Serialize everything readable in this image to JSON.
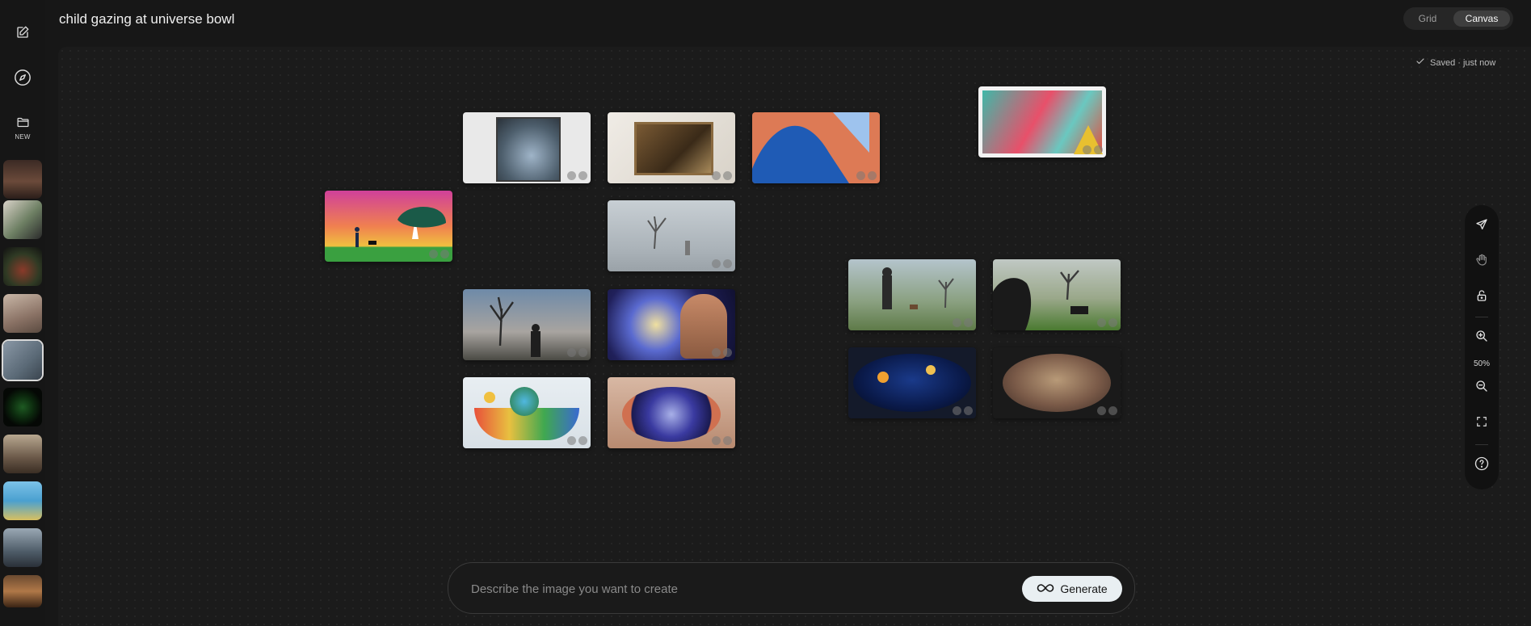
{
  "header": {
    "title": "child gazing at universe bowl"
  },
  "view_toggle": {
    "grid_label": "Grid",
    "canvas_label": "Canvas",
    "selected": "Canvas"
  },
  "sidebar": {
    "new_label": "NEW",
    "icons": [
      "edit-icon",
      "compass-icon",
      "folder-icon"
    ],
    "history_count_visible": 10
  },
  "status": {
    "saved_text": "Saved · just now"
  },
  "toolbar": {
    "zoom_label": "50%"
  },
  "prompt": {
    "placeholder": "Describe the image you want to create",
    "generate_label": "Generate"
  },
  "colors": {
    "background": "#171717",
    "accent_button": "#e9eff2"
  }
}
